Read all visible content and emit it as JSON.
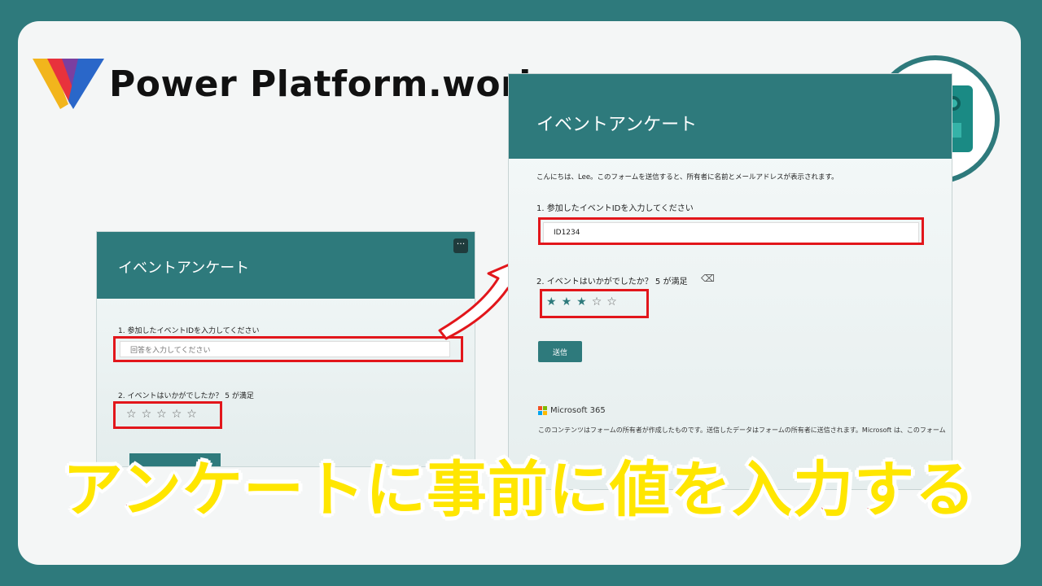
{
  "brand": {
    "name": "Power Platform.work"
  },
  "form_before": {
    "title": "イベントアンケート",
    "more_label": "···",
    "q1_label": "1. 参加したイベントIDを入力してください",
    "q1_placeholder": "回答を入力してください",
    "q2_label": "2. イベントはいかがでしたか？ 5 が満足",
    "rating_value": 0,
    "rating_max": 5
  },
  "form_after": {
    "title": "イベントアンケート",
    "greeting": "こんにちは、Lee。このフォームを送信すると、所有者に名前とメールアドレスが表示されます。",
    "q1_label": "1. 参加したイベントIDを入力してください",
    "q1_value": "ID1234",
    "q2_label": "2. イベントはいかがでしたか？ 5 が満足",
    "rating_value": 3,
    "rating_max": 5,
    "submit_label": "送信",
    "ms_brand": "Microsoft 365",
    "disclaimer": "このコンテンツはフォームの所有者が作成したものです。送信したデータはフォームの所有者に送信されます。Microsoft は、このフォーム"
  },
  "headline": "アンケートに事前に値を入力する",
  "colors": {
    "teal": "#2e7a7c",
    "highlight": "#e2161b",
    "headline_fill": "#ffe600"
  },
  "icons": {
    "brand": "power-platform-logo-icon",
    "forms": "microsoft-forms-icon"
  }
}
